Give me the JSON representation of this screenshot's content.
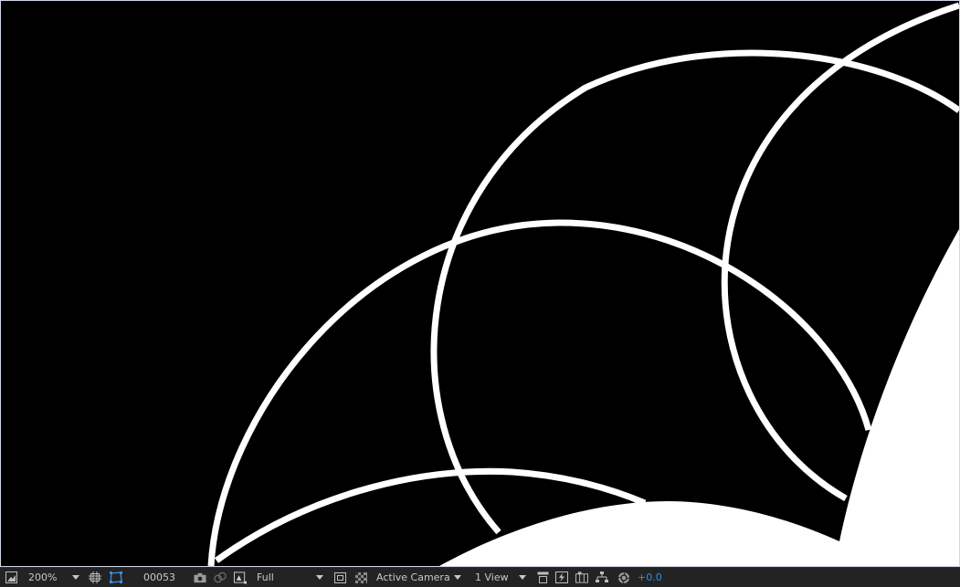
{
  "viewer": {
    "background": "#000000",
    "stroke_color": "#ffffff"
  },
  "toolbar": {
    "magnification": "200%",
    "timecode": "00053",
    "resolution": "Full",
    "camera": "Active Camera",
    "views": "1 View",
    "exposure": "+0.0",
    "exposure_color": "#2f8fd8"
  },
  "icons": [
    "always-preview-icon",
    "magnification-dropdown-icon",
    "grid-guides-icon",
    "mask-visibility-icon",
    "snapshot-camera-icon",
    "show-snapshot-icon",
    "color-channel-icon",
    "resolution-dropdown-icon",
    "region-of-interest-icon",
    "transparency-grid-icon",
    "camera-dropdown-icon",
    "views-dropdown-icon",
    "toggle-pixel-aspect-icon",
    "fast-previews-icon",
    "timeline-icon",
    "flowchart-icon",
    "reset-exposure-icon"
  ]
}
